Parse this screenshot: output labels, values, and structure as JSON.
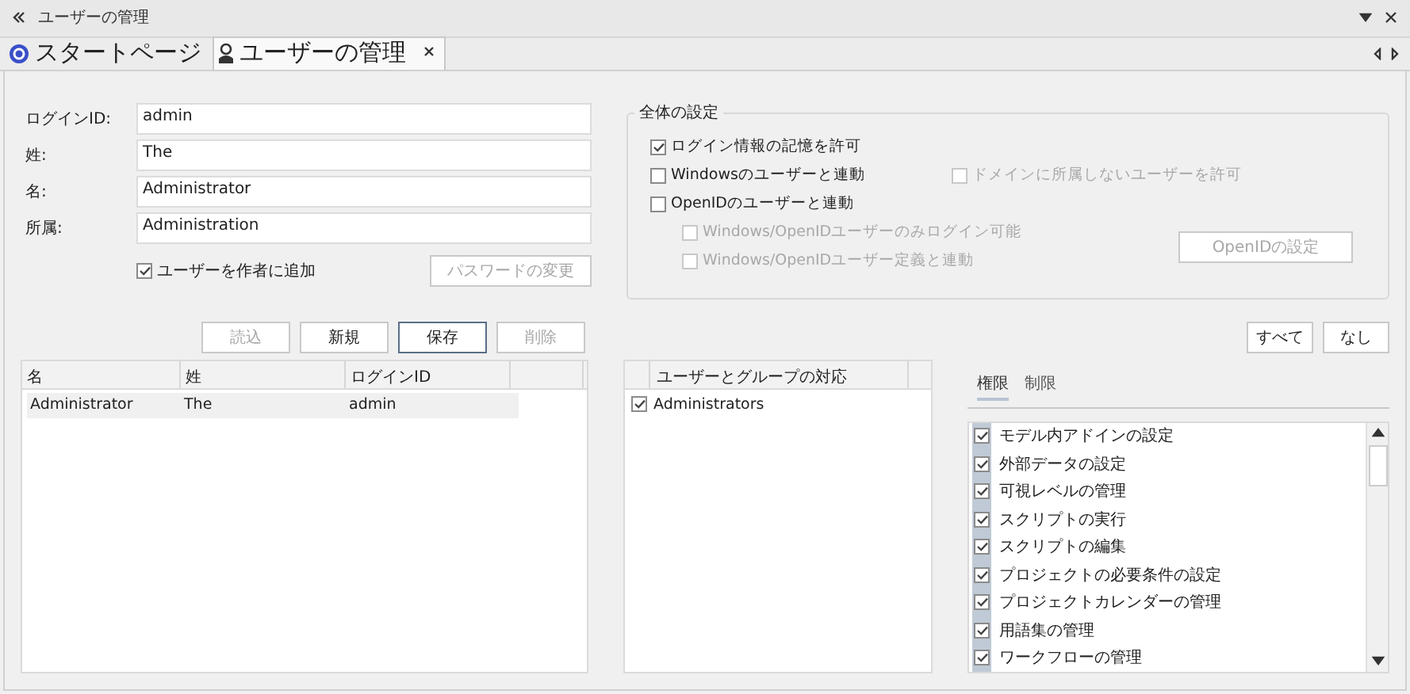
{
  "window": {
    "title": "ユーザーの管理"
  },
  "tabs": [
    {
      "label": "スタートページ",
      "selected": false,
      "closable": false
    },
    {
      "label": "ユーザーの管理",
      "selected": true,
      "closable": true
    }
  ],
  "user_form": {
    "fields": [
      {
        "label": "ログインID:",
        "value": "admin"
      },
      {
        "label": "姓:",
        "value": "The"
      },
      {
        "label": "名:",
        "value": "Administrator"
      },
      {
        "label": "所属:",
        "value": "Administration"
      }
    ],
    "add_author": {
      "label": "ユーザーを作者に追加",
      "checked": true
    },
    "password_button": {
      "label": "パスワードの変更",
      "disabled": true
    }
  },
  "global_settings": {
    "title": "全体の設定",
    "options": [
      {
        "label": "ログイン情報の記憶を許可",
        "checked": true,
        "disabled": false,
        "indented": false
      },
      {
        "label": "Windowsのユーザーと連動",
        "checked": false,
        "disabled": false,
        "indented": false
      },
      {
        "label": "ドメインに所属しないユーザーを許可",
        "checked": false,
        "disabled": true,
        "indented": false
      },
      {
        "label": "OpenIDのユーザーと連動",
        "checked": false,
        "disabled": false,
        "indented": false
      },
      {
        "label": "Windows/OpenIDユーザーのみログイン可能",
        "checked": false,
        "disabled": true,
        "indented": true
      },
      {
        "label": "Windows/OpenIDユーザー定義と連動",
        "checked": false,
        "disabled": true,
        "indented": true
      }
    ],
    "openid_button": {
      "label": "OpenIDの設定",
      "disabled": true
    }
  },
  "actions": [
    {
      "label": "読込",
      "disabled": true,
      "focused": false
    },
    {
      "label": "新規",
      "disabled": false,
      "focused": false
    },
    {
      "label": "保存",
      "disabled": false,
      "focused": true
    },
    {
      "label": "削除",
      "disabled": true,
      "focused": false
    }
  ],
  "users_table": {
    "columns": [
      "名",
      "姓",
      "ログインID"
    ],
    "rows": [
      {
        "cells": [
          "Administrator",
          "The",
          "admin"
        ],
        "selected": true
      }
    ]
  },
  "groups": {
    "header": "ユーザーとグループの対応",
    "items": [
      {
        "label": "Administrators",
        "checked": true
      }
    ]
  },
  "select_buttons": [
    "すべて",
    "なし"
  ],
  "permission_tabs": [
    {
      "label": "権限",
      "selected": true
    },
    {
      "label": "制限",
      "selected": false
    }
  ],
  "permissions": [
    {
      "label": "モデル内アドインの設定",
      "checked": true
    },
    {
      "label": "外部データの設定",
      "checked": true
    },
    {
      "label": "可視レベルの管理",
      "checked": true
    },
    {
      "label": "スクリプトの実行",
      "checked": true
    },
    {
      "label": "スクリプトの編集",
      "checked": true
    },
    {
      "label": "プロジェクトの必要条件の設定",
      "checked": true
    },
    {
      "label": "プロジェクトカレンダーの管理",
      "checked": true
    },
    {
      "label": "用語集の管理",
      "checked": true
    },
    {
      "label": "ワークフローの管理",
      "checked": true
    }
  ]
}
